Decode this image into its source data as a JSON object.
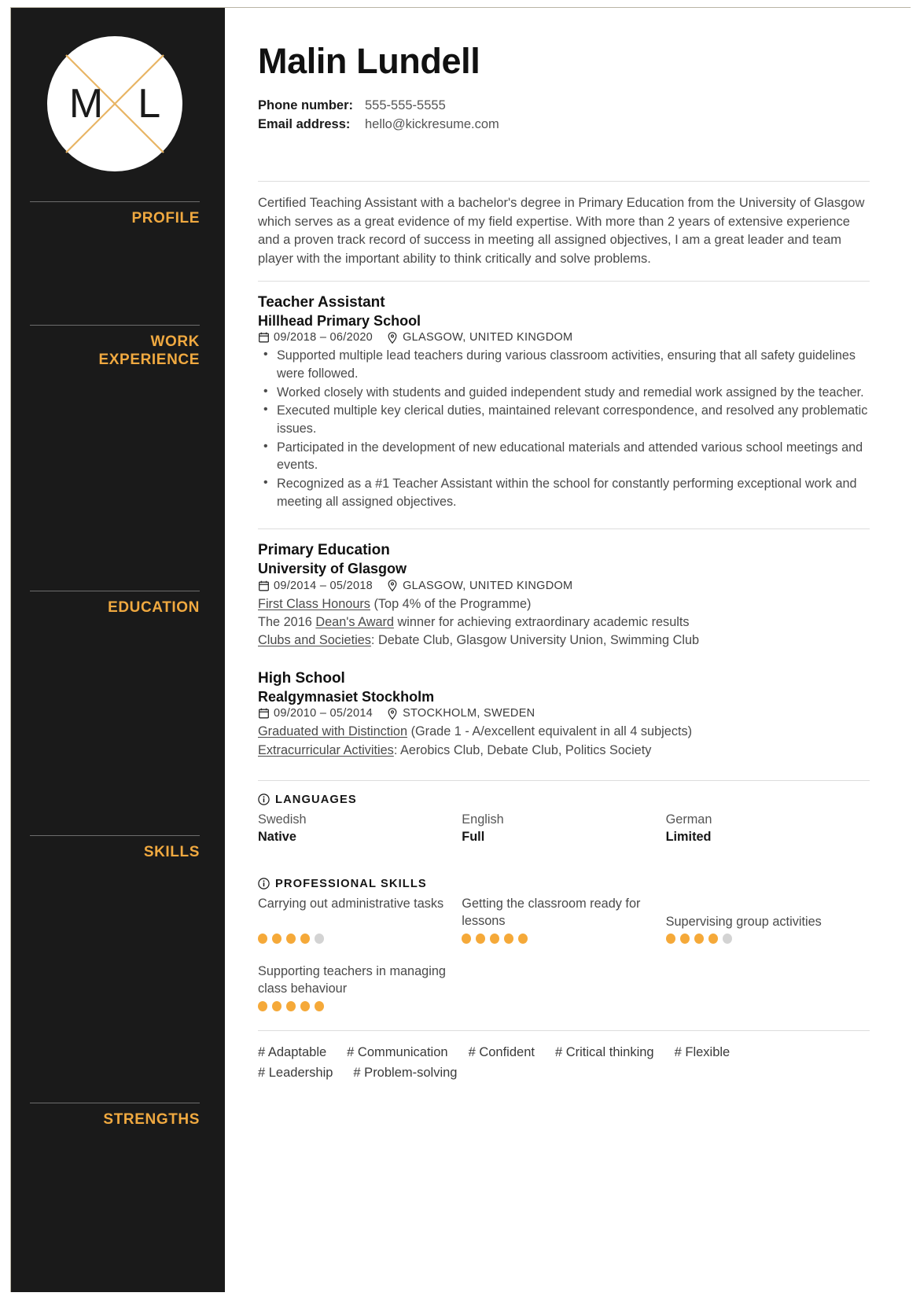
{
  "sidebar": {
    "logo": {
      "initial_first": "M",
      "initial_last": "L",
      "cross_color": "#e8b565"
    },
    "accent_color": "#f0a940",
    "background_color": "#1a1a1a",
    "sections": [
      {
        "label": "PROFILE"
      },
      {
        "label": "WORK\nEXPERIENCE"
      },
      {
        "label": "EDUCATION"
      },
      {
        "label": "SKILLS"
      },
      {
        "label": "STRENGTHS"
      }
    ],
    "labels": {
      "profile": "PROFILE",
      "work_line1": "WORK",
      "work_line2": "EXPERIENCE",
      "education": "EDUCATION",
      "skills": "SKILLS",
      "strengths": "STRENGTHS"
    }
  },
  "header": {
    "name": "Malin Lundell",
    "phone_label": "Phone number:",
    "phone_value": "555-555-5555",
    "email_label": "Email address:",
    "email_value": "hello@kickresume.com"
  },
  "profile": {
    "text": "Certified Teaching Assistant with a bachelor's degree in Primary Education from the University of Glasgow which serves as a great evidence of my field expertise. With more than 2 years of extensive experience and a proven track record of success in meeting all assigned objectives, I am a great leader and team player with the important ability to think critically and solve problems."
  },
  "work_experience": [
    {
      "position": "Teacher Assistant",
      "organization": "Hillhead Primary School",
      "dates": "09/2018 – 06/2020",
      "location": "GLASGOW, UNITED KINGDOM",
      "bullets": [
        "Supported multiple lead teachers during various classroom activities, ensuring that all safety guidelines were followed.",
        "Worked closely with students and guided independent study and remedial work assigned by the teacher.",
        "Executed multiple key clerical duties, maintained relevant correspondence, and resolved any problematic issues.",
        "Participated in the development of new educational materials and attended various school meetings and events.",
        "Recognized as a #1 Teacher Assistant within the school for constantly performing exceptional work and meeting all assigned objectives."
      ]
    }
  ],
  "education": [
    {
      "program": "Primary Education",
      "institution": "University of Glasgow",
      "dates": "09/2014 – 05/2018",
      "location": "GLASGOW, UNITED KINGDOM",
      "details": [
        {
          "underlined": "First Class Honours",
          "rest": " (Top 4% of the Programme)",
          "prefix": ""
        },
        {
          "prefix": "The 2016 ",
          "underlined": "Dean's Award",
          "rest": " winner for achieving extraordinary academic results"
        },
        {
          "prefix": "",
          "underlined": "Clubs and Societies",
          "rest": ": Debate Club, Glasgow University Union, Swimming Club"
        }
      ]
    },
    {
      "program": "High School",
      "institution": "Realgymnasiet Stockholm",
      "dates": "09/2010 – 05/2014",
      "location": "STOCKHOLM, SWEDEN",
      "details": [
        {
          "prefix": "",
          "underlined": "Graduated with Distinction",
          "rest": " (Grade 1 - A/excellent equivalent in all 4 subjects)"
        },
        {
          "prefix": "",
          "underlined": "Extracurricular Activities",
          "rest": ": Aerobics Club, Debate Club, Politics Society"
        }
      ]
    }
  ],
  "languages": {
    "heading": "LANGUAGES",
    "items": [
      {
        "name": "Swedish",
        "level": "Native"
      },
      {
        "name": "English",
        "level": "Full"
      },
      {
        "name": "German",
        "level": "Limited"
      }
    ]
  },
  "professional_skills": {
    "heading": "PROFESSIONAL SKILLS",
    "max_rating": 5,
    "items": [
      {
        "name": "Carrying out administrative tasks",
        "rating": 4
      },
      {
        "name": "Getting the classroom ready for lessons",
        "rating": 5
      },
      {
        "name": "Supervising group activities",
        "rating": 4
      },
      {
        "name": "Supporting teachers in managing class behaviour",
        "rating": 5
      }
    ]
  },
  "strengths": {
    "tags": [
      "# Adaptable",
      "# Communication",
      "# Confident",
      "# Critical thinking",
      "# Flexible",
      "# Leadership",
      "# Problem-solving"
    ]
  },
  "colors": {
    "accent": "#f0a940",
    "dot_filled": "#f5a939",
    "dot_empty": "#d3d3d3",
    "sidebar_bg": "#1a1a1a",
    "body_text": "#4a4a4a"
  }
}
